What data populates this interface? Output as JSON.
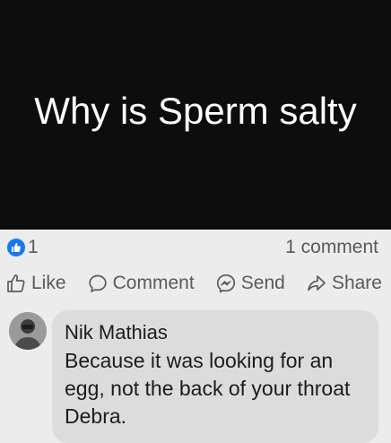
{
  "post": {
    "image_text": "Why is Sperm salty"
  },
  "stats": {
    "reaction_icon": "like-icon",
    "reaction_count": "1",
    "comment_count": "1 comment"
  },
  "actions": {
    "like_label": "Like",
    "comment_label": "Comment",
    "send_label": "Send",
    "share_label": "Share"
  },
  "comment": {
    "author": "Nik Mathias",
    "text": "Because it was looking for an egg, not the back of your throat Debra."
  },
  "colors": {
    "brand_blue": "#1877f2",
    "image_background": "#0d0d0d",
    "bubble": "#dcdcdc"
  }
}
